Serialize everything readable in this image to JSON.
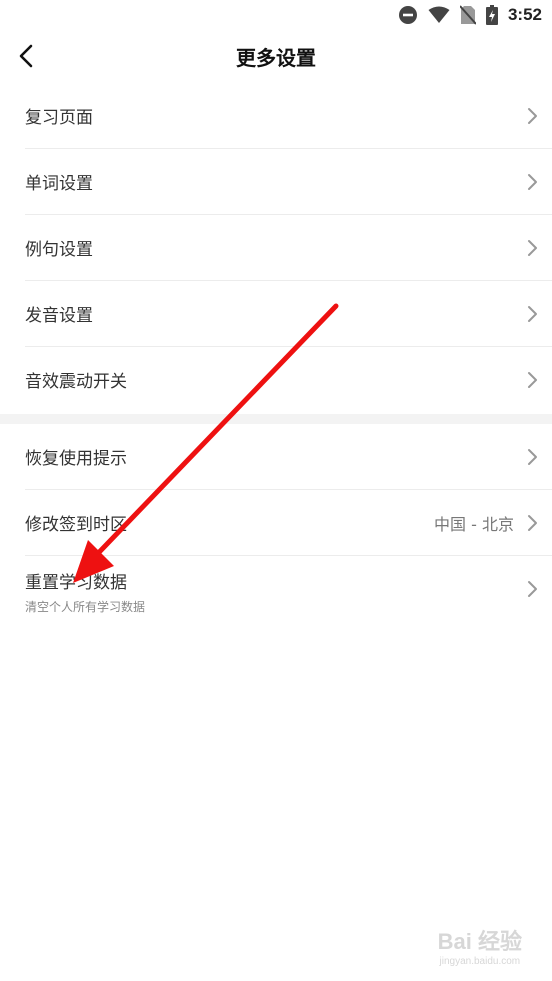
{
  "status_bar": {
    "time": "3:52",
    "icons": [
      "do-not-disturb-icon",
      "wifi-icon",
      "no-sim-icon",
      "battery-charging-icon"
    ]
  },
  "header": {
    "title": "更多设置"
  },
  "settings": {
    "group1": [
      {
        "label": "复习页面"
      },
      {
        "label": "单词设置"
      },
      {
        "label": "例句设置"
      },
      {
        "label": "发音设置"
      },
      {
        "label": "音效震动开关"
      }
    ],
    "group2": [
      {
        "label": "恢复使用提示"
      },
      {
        "label": "修改签到时区",
        "value": "中国 - 北京"
      },
      {
        "label": "重置学习数据",
        "sublabel": "清空个人所有学习数据"
      }
    ]
  },
  "watermark": {
    "main": "Bai 经验",
    "sub": "jingyan.baidu.com"
  },
  "colors": {
    "annotation_arrow": "#ee1111",
    "divider_band": "#f3f3f3"
  }
}
